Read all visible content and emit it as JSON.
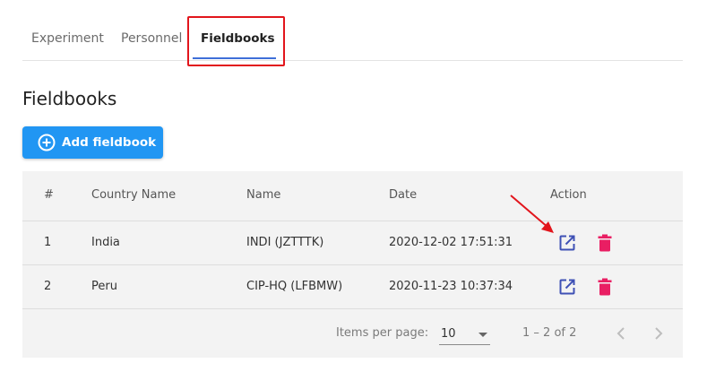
{
  "tabs": [
    {
      "label": "Experiment"
    },
    {
      "label": "Personnel"
    },
    {
      "label": "Fieldbooks",
      "active": true
    }
  ],
  "section_title": "Fieldbooks",
  "add_button": {
    "label": "Add fieldbook",
    "icon": "plus-circle-icon"
  },
  "table": {
    "headers": [
      "#",
      "Country Name",
      "Name",
      "Date",
      "Action"
    ],
    "rows": [
      {
        "num": "1",
        "country": "India",
        "name": "INDI (JZTTTK)",
        "date": "2020-12-02 17:51:31"
      },
      {
        "num": "2",
        "country": "Peru",
        "name": "CIP-HQ (LFBMW)",
        "date": "2020-11-23 10:37:34"
      }
    ]
  },
  "paginator": {
    "items_per_page_label": "Items per page:",
    "page_size": "10",
    "range": "1 – 2 of 2"
  },
  "colors": {
    "primary": "#2196f3",
    "tab_ink": "#3f6fd8",
    "open_icon": "#3f51b5",
    "delete_icon": "#e91e63",
    "annotation": "#e2151c"
  },
  "icons": {
    "open": "open-in-new-icon",
    "delete": "trash-icon",
    "prev": "chevron-left-icon",
    "next": "chevron-right-icon"
  }
}
